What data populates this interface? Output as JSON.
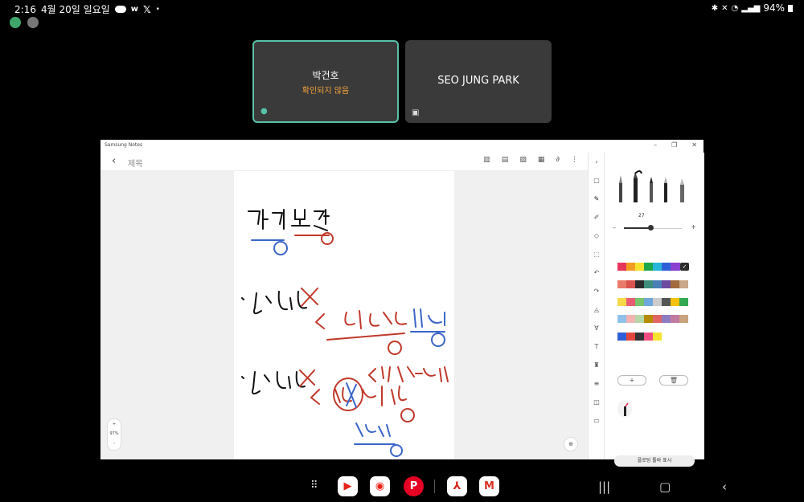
{
  "status": {
    "time": "2:16",
    "date": "4월 20일 일요일",
    "battery": "94%"
  },
  "tiles": [
    {
      "name": "박건호",
      "subtitle": "확인되지 않음"
    },
    {
      "name": "SEO JUNG PARK"
    }
  ],
  "window": {
    "title": "Samsung Notes",
    "doc_title": "제목",
    "zoom_level": "97%"
  },
  "panel": {
    "pen_size": "27",
    "add_label": "+",
    "delete_icon": "trash-icon",
    "floating_toolbar_label": "플로팅 툴바 표시",
    "palette": [
      [
        "#e8365b",
        "#f39c22",
        "#f7e22e",
        "#1da74a",
        "#27b6d8",
        "#2e5fd9",
        "#8b3fd1"
      ],
      [
        "#e87b6a",
        "#d9534f",
        "#2b2b2b",
        "#3e8e7e",
        "#4a7fb5",
        "#6b4aa0",
        "#a36b3b",
        "#c8a78a"
      ],
      [
        "#f5d94a",
        "#e85d75",
        "#7ac46b",
        "#6fa8dc",
        "#cccccc",
        "#555555",
        "#f4c20d",
        "#34a853"
      ],
      [
        "#8fc1e8",
        "#f2b3b3",
        "#b6d7a8",
        "#b58b00",
        "#e06666",
        "#8e7cc3",
        "#c27ba0",
        "#c9a27e"
      ],
      [
        "#2f5fd8",
        "#e2463c",
        "#333333",
        "#f04e80",
        "#f7e22e"
      ]
    ],
    "selected_color": "#2b2b2b"
  },
  "apps": [
    "YouTube",
    "YouTube Music",
    "Pinterest",
    "Acrobat",
    "Gmail"
  ]
}
